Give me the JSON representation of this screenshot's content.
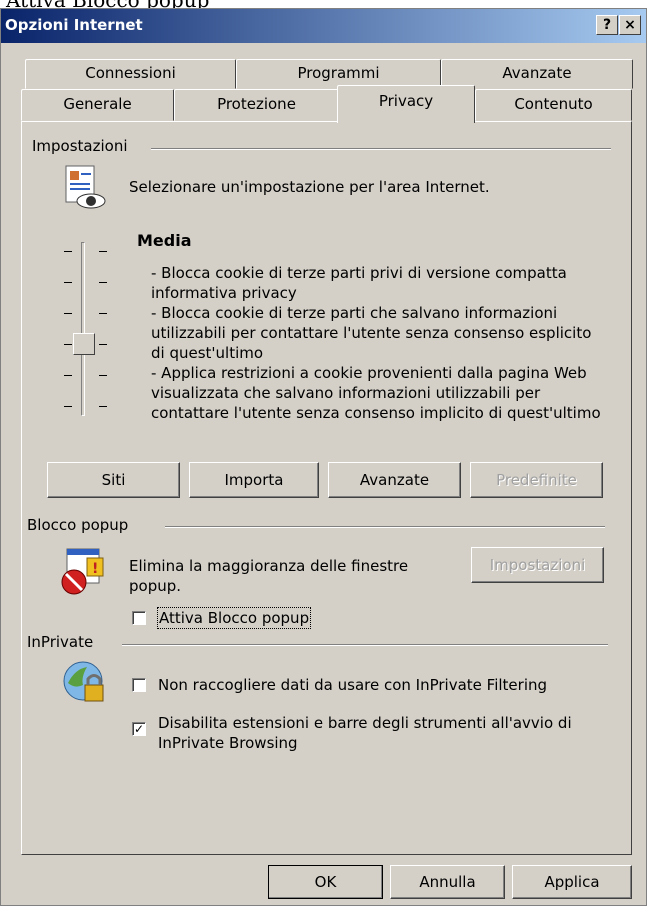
{
  "window": {
    "title": "Opzioni Internet",
    "help_label": "?",
    "close_label": "×"
  },
  "tabs_row1": [
    "Connessioni",
    "Programmi",
    "Avanzate"
  ],
  "tabs_row2": [
    "Generale",
    "Protezione",
    "Privacy",
    "Contenuto"
  ],
  "selected_tab": "Privacy",
  "privacy": {
    "group_title": "Impostazioni",
    "intro": "Selezionare un'impostazione per l'area Internet.",
    "level_title": "Media",
    "level_desc": [
      "- Blocca cookie di terze parti privi di versione compatta",
      "informativa privacy",
      "- Blocca cookie di terze parti che salvano informazioni",
      "utilizzabili per contattare l'utente senza consenso esplicito",
      "di quest'ultimo",
      "- Applica restrizioni a cookie provenienti dalla pagina Web",
      "visualizzata che salvano informazioni utilizzabili per",
      "contattare l'utente senza consenso implicito di quest'ultimo"
    ],
    "slider_level": "Media",
    "buttons": {
      "sites": "Siti",
      "import": "Importa",
      "advanced": "Avanzate",
      "default": "Predefinite"
    }
  },
  "popup": {
    "group_title": "Blocco popup",
    "desc_line1": "Elimina la maggioranza delle finestre",
    "desc_line2": "popup.",
    "settings_button": "Impostazioni",
    "enable_checkbox": "Attiva Blocco popup",
    "enable_checked": false
  },
  "inprivate": {
    "group_title": "InPrivate",
    "filtering_checkbox": "Non raccogliere dati da usare con InPrivate Filtering",
    "filtering_checked": false,
    "disable_ext_line1": "Disabilita estensioni e barre degli strumenti all'avvio di",
    "disable_ext_line2": "InPrivate Browsing",
    "disable_ext_checked": true
  },
  "footer": {
    "ok": "OK",
    "cancel": "Annulla",
    "apply": "Applica"
  }
}
